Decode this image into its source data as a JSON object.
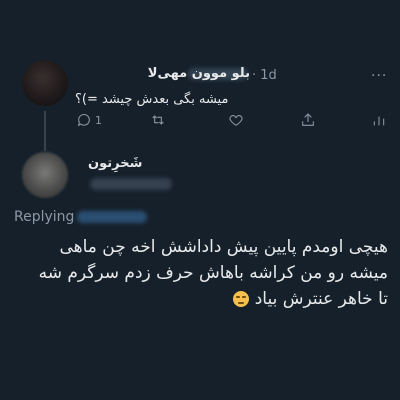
{
  "reply_parent": {
    "display_name": "بلو موون مهی‌لا",
    "time": "· 1d",
    "text": "میشه بگی بعدش چیشد =)؟",
    "reply_count": "1",
    "more_label": "···"
  },
  "reply": {
    "display_name": "شَخرِتون",
    "replying_label": "Replying",
    "lines": [
      "هیچی اومدم پایین پیش داداشش اخه چن ماهی",
      "میشه رو من کراشه باهاش حرف زدم سرگرم شه",
      "تا خاهر عنترش بیاد"
    ],
    "emoji": "unamused-face"
  },
  "colors": {
    "background": "#15202b",
    "text": "#e7e9ea",
    "muted": "#8b98a5"
  }
}
